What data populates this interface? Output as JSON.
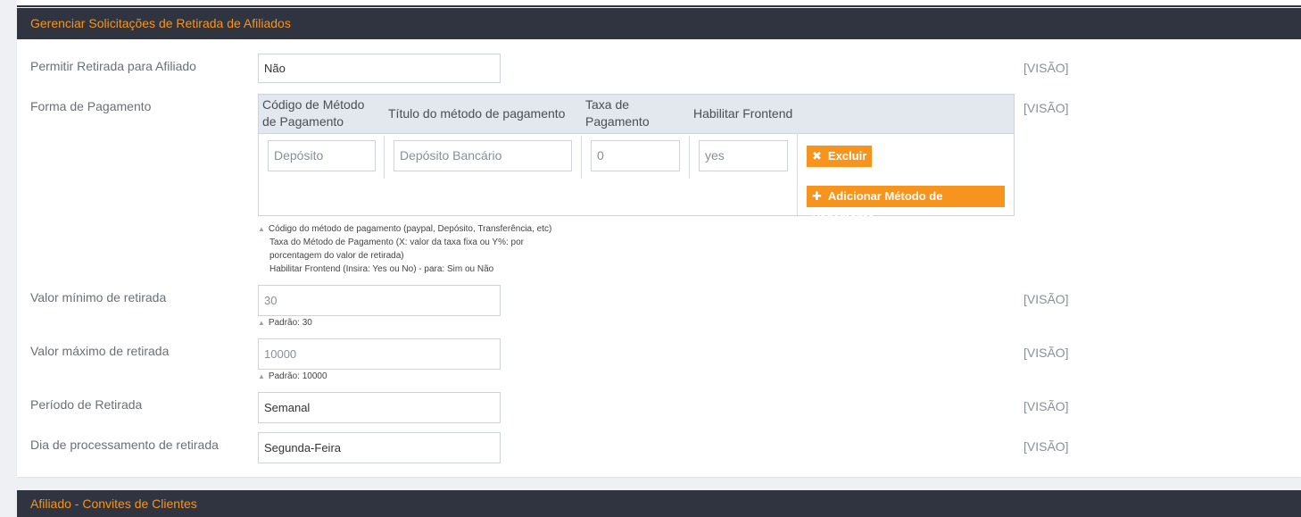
{
  "panel": {
    "title": "Gerenciar Solicitações de Retirada de Afiliados",
    "view_link": "[VISÃO]",
    "rows": {
      "allow": {
        "label": "Permitir Retirada para Afiliado",
        "value": "Não"
      },
      "payment": {
        "label": "Forma de Pagamento",
        "columns": [
          "Código de Método de Pagamento",
          "Título do método de pagamento",
          "Taxa de Pagamento",
          "Habilitar Frontend"
        ],
        "col0_line1": "Código de Método",
        "col0_line2": "de Pagamento",
        "col2_line1": "Taxa de",
        "col2_line2": "Pagamento",
        "placeholders": {
          "code": "Depósito",
          "title": "Depósito Bancário",
          "fee": "0",
          "frontend": "yes"
        },
        "delete_label": "Excluir",
        "add_label": "Adicionar Método de Pagamento",
        "hint_lines": [
          "Código do método de pagamento (paypal, Depósito, Transferência, etc)",
          "Taxa do Método de Pagamento (X: valor da taxa fixa ou Y%: por",
          "porcentagem do valor de retirada)",
          "Habilitar Frontend (Insira: Yes ou No) - para: Sim ou Não"
        ]
      },
      "min": {
        "label": "Valor mínimo de retirada",
        "value": "30",
        "hint": "Padrão: 30"
      },
      "max": {
        "label": "Valor máximo de retirada",
        "value": "10000",
        "hint": "Padrão: 10000"
      },
      "period": {
        "label": "Período de Retirada",
        "value": "Semanal"
      },
      "day": {
        "label": "Dia de processamento de retirada",
        "value": "Segunda-Feira"
      }
    }
  },
  "panel2": {
    "title": "Afiliado - Convites de Clientes"
  },
  "colors": {
    "header_bg": "#2f3440",
    "accent": "#f7941d",
    "table_head": "#e3e7ee"
  }
}
